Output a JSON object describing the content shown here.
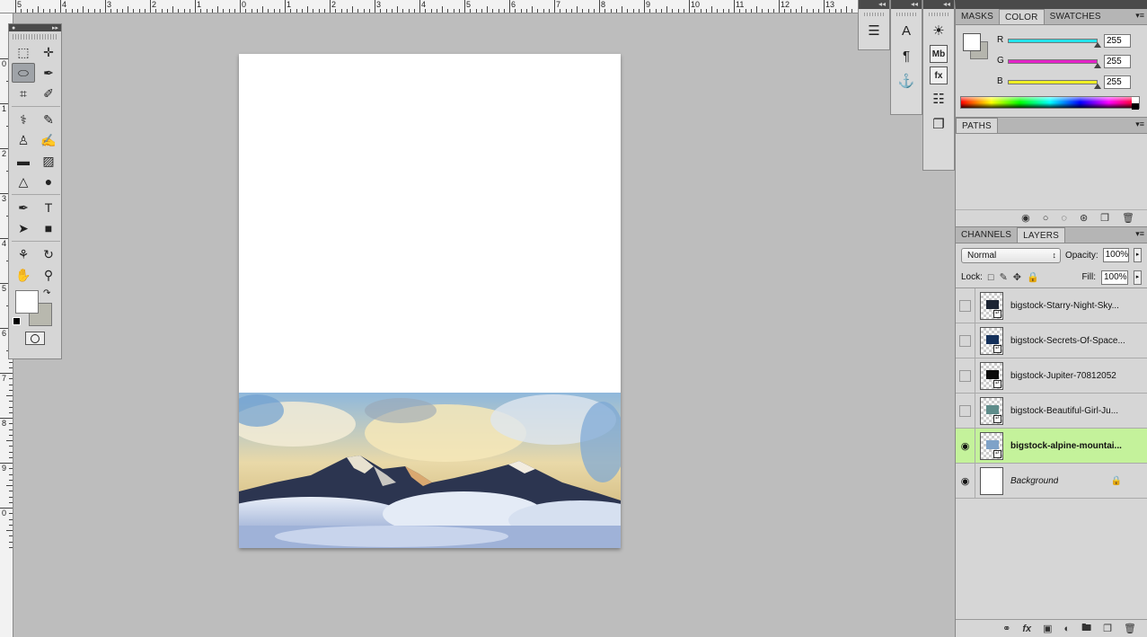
{
  "ruler_top": [
    "5",
    "4",
    "3",
    "2",
    "1",
    "0",
    "1",
    "2",
    "3",
    "4",
    "5",
    "6",
    "7",
    "8",
    "9",
    "10",
    "11",
    "12",
    "13"
  ],
  "ruler_left": [
    "0",
    "1",
    "2",
    "3",
    "4",
    "5",
    "6",
    "7",
    "8",
    "9",
    "0"
  ],
  "tools_panel": {
    "tools": [
      {
        "name": "rect-marquee-tool",
        "glyph": "⬚",
        "active": false
      },
      {
        "name": "move-tool",
        "glyph": "✛",
        "active": false
      },
      {
        "name": "lasso-tool",
        "glyph": "⬭",
        "active": true
      },
      {
        "name": "quick-selection-tool",
        "glyph": "✒",
        "active": false
      },
      {
        "name": "crop-tool",
        "glyph": "⌗",
        "active": false
      },
      {
        "name": "eyedropper-tool",
        "glyph": "✐",
        "active": false
      },
      {
        "name": "spot-healing-tool",
        "glyph": "⚕",
        "active": false
      },
      {
        "name": "brush-tool",
        "glyph": "✎",
        "active": false
      },
      {
        "name": "clone-stamp-tool",
        "glyph": "♙",
        "active": false
      },
      {
        "name": "history-brush-tool",
        "glyph": "✍",
        "active": false
      },
      {
        "name": "eraser-tool",
        "glyph": "▬",
        "active": false
      },
      {
        "name": "gradient-tool",
        "glyph": "▨",
        "active": false
      },
      {
        "name": "blur-tool",
        "glyph": "△",
        "active": false
      },
      {
        "name": "dodge-tool",
        "glyph": "●",
        "active": false
      },
      {
        "name": "pen-tool",
        "glyph": "✒",
        "active": false
      },
      {
        "name": "type-tool",
        "glyph": "T",
        "active": false
      },
      {
        "name": "path-selection-tool",
        "glyph": "➤",
        "active": false
      },
      {
        "name": "rectangle-shape-tool",
        "glyph": "■",
        "active": false
      },
      {
        "name": "3d-rotate-tool",
        "glyph": "⚘",
        "active": false
      },
      {
        "name": "3d-orbit-tool",
        "glyph": "↻",
        "active": false
      },
      {
        "name": "hand-tool",
        "glyph": "✋",
        "active": false
      },
      {
        "name": "zoom-tool",
        "glyph": "⚲",
        "active": false
      }
    ]
  },
  "strips": {
    "strip1": [
      {
        "name": "tool-presets-icon",
        "glyph": "☰"
      }
    ],
    "strip2": [
      {
        "name": "character-panel-icon",
        "glyph": "A"
      },
      {
        "name": "paragraph-panel-icon",
        "glyph": "¶"
      },
      {
        "name": "clone-source-icon",
        "glyph": "⚓"
      }
    ],
    "strip3": [
      {
        "name": "adjustments-panel-icon",
        "glyph": "☀"
      },
      {
        "name": "mini-bridge-icon",
        "glyph": "Mb"
      },
      {
        "name": "styles-panel-icon",
        "glyph": "fx"
      },
      {
        "name": "notes-panel-icon",
        "glyph": "☷"
      },
      {
        "name": "layer-comps-icon",
        "glyph": "❐"
      }
    ]
  },
  "color_panel": {
    "tabs": [
      "MASKS",
      "COLOR",
      "SWATCHES"
    ],
    "selected_tab": "COLOR",
    "channels": [
      {
        "label": "R",
        "value": "255",
        "color": "#23e2ea"
      },
      {
        "label": "G",
        "value": "255",
        "color": "#e423c8"
      },
      {
        "label": "B",
        "value": "255",
        "color": "#efef23"
      }
    ]
  },
  "paths_panel": {
    "tabs": [
      "PATHS"
    ]
  },
  "layers_panel": {
    "tabs": [
      "CHANNELS",
      "LAYERS"
    ],
    "selected_tab": "LAYERS",
    "blend_mode": "Normal",
    "opacity_label": "Opacity:",
    "opacity": "100%",
    "lock_label": "Lock:",
    "fill_label": "Fill:",
    "fill": "100%",
    "layers": [
      {
        "name": "bigstock-Starry-Night-Sky...",
        "visible": false,
        "selected": false,
        "thumb": "#1c2433",
        "smart": true
      },
      {
        "name": "bigstock-Secrets-Of-Space...",
        "visible": false,
        "selected": false,
        "thumb": "#14305a",
        "smart": true
      },
      {
        "name": "bigstock-Jupiter-70812052",
        "visible": false,
        "selected": false,
        "thumb": "#0b0b0b",
        "smart": true
      },
      {
        "name": "bigstock-Beautiful-Girl-Ju...",
        "visible": false,
        "selected": false,
        "thumb": "#5e8c8a",
        "smart": true
      },
      {
        "name": "bigstock-alpine-mountai...",
        "visible": true,
        "selected": true,
        "thumb": "#7fa2c8",
        "smart": true
      },
      {
        "name": "Background",
        "visible": true,
        "selected": false,
        "thumb": "#ffffff",
        "smart": false,
        "italic": true,
        "locked": true
      }
    ]
  }
}
